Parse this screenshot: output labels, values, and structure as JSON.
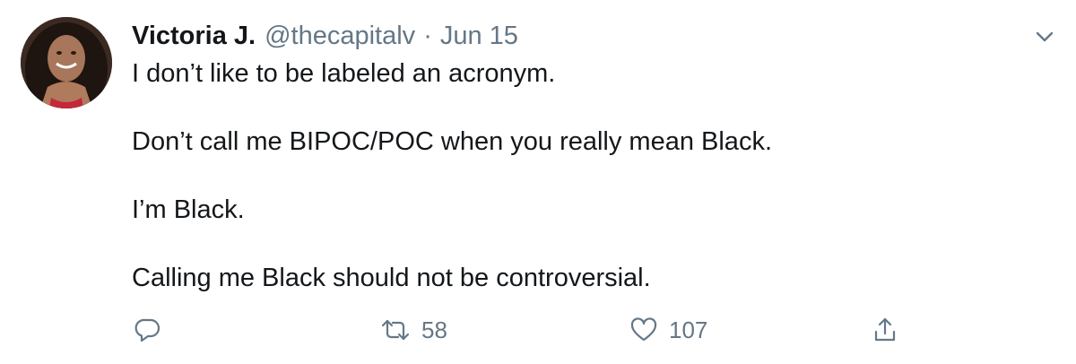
{
  "tweet": {
    "author": {
      "display_name": "Victoria J.",
      "handle": "@thecapitalv"
    },
    "separator": "·",
    "date": "Jun 15",
    "lines": [
      "I don’t like to be labeled an acronym.",
      "Don’t call me BIPOC/POC when you really mean Black.",
      "I’m Black.",
      "Calling me Black should not be controversial."
    ],
    "actions": {
      "reply_icon": "reply-icon",
      "retweet_icon": "retweet-icon",
      "retweet_count": "58",
      "like_icon": "heart-icon",
      "like_count": "107",
      "share_icon": "share-icon"
    },
    "menu_icon": "chevron-down-icon"
  },
  "colors": {
    "text": "#14171a",
    "secondary": "#657786",
    "background": "#ffffff"
  }
}
